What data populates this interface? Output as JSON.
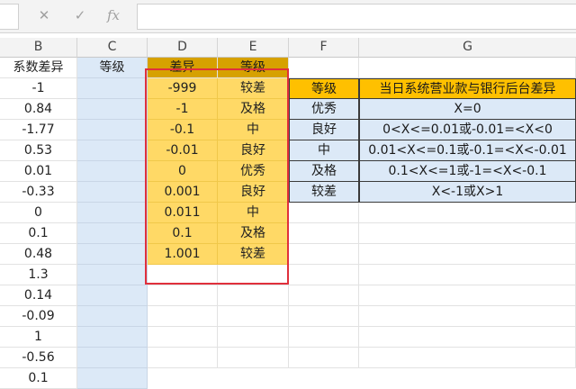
{
  "formula_bar": {
    "cancel_glyph": "✕",
    "confirm_glyph": "✓",
    "fx_glyph": "fx",
    "value": ""
  },
  "columns": [
    "B",
    "C",
    "D",
    "E",
    "F",
    "G"
  ],
  "col_b": {
    "header": "系数差异",
    "values": [
      "-1",
      "0.84",
      "-1.77",
      "0.53",
      "0.01",
      "-0.33",
      "0",
      "0.1",
      "0.48",
      "1.3",
      "0.14",
      "-0.09",
      "1",
      "-0.56",
      "0.1"
    ]
  },
  "col_c": {
    "header": "等级"
  },
  "table_de": {
    "header_d": "差异",
    "header_e": "等级",
    "rows": [
      {
        "diff": "-999",
        "grade": "较差"
      },
      {
        "diff": "-1",
        "grade": "及格"
      },
      {
        "diff": "-0.1",
        "grade": "中"
      },
      {
        "diff": "-0.01",
        "grade": "良好"
      },
      {
        "diff": "0",
        "grade": "优秀"
      },
      {
        "diff": "0.001",
        "grade": "良好"
      },
      {
        "diff": "0.011",
        "grade": "中"
      },
      {
        "diff": "0.1",
        "grade": "及格"
      },
      {
        "diff": "1.001",
        "grade": "较差"
      }
    ]
  },
  "reference_table": {
    "header_f": "等级",
    "header_g": "当日系统营业款与银行后台差异",
    "rows": [
      {
        "grade": "优秀",
        "rule": "X=0"
      },
      {
        "grade": "良好",
        "rule": "0<X<=0.01或-0.01=<X<0"
      },
      {
        "grade": "中",
        "rule": "0.01<X<=0.1或-0.1=<X<-0.01"
      },
      {
        "grade": "及格",
        "rule": "0.1<X<=1或-1=<X<-0.1"
      },
      {
        "grade": "较差",
        "rule": "X<-1或X>1"
      }
    ]
  },
  "colors": {
    "header_dark_gold": "#d6a100",
    "data_yellow": "#ffd966",
    "ref_orange": "#ffc000",
    "grade_blue": "#dce9f7",
    "highlight_red": "#e0303c"
  }
}
